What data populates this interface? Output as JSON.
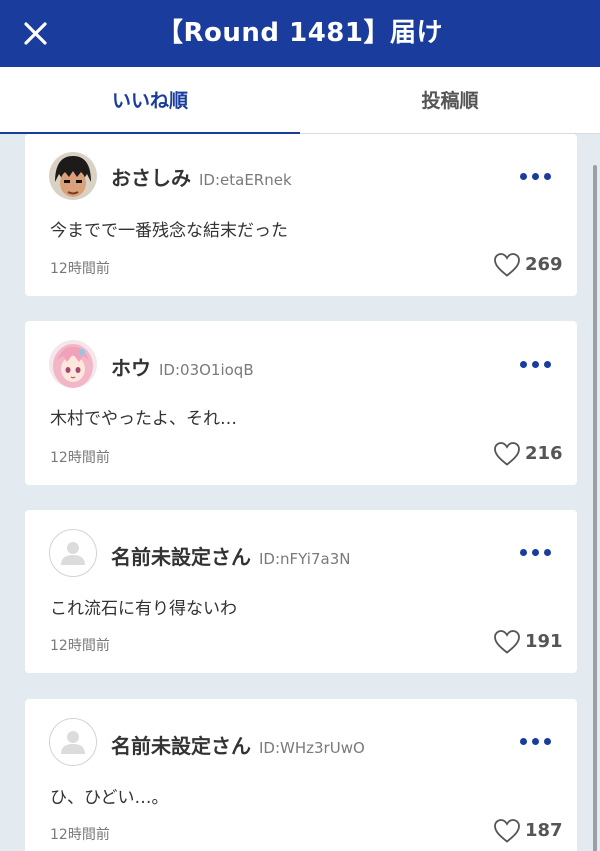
{
  "header": {
    "title": "【Round 1481】届け",
    "close_icon": "close-icon"
  },
  "tabs": [
    {
      "label": "いいね順",
      "active": true
    },
    {
      "label": "投稿順",
      "active": false
    }
  ],
  "colors": {
    "brand": "#1a3c9c",
    "background": "#e3eaf0",
    "card": "#ffffff",
    "text": "#333333",
    "muted": "#7a7a7a"
  },
  "comments": [
    {
      "name": "おさしみ",
      "id": "ID:etaERnek",
      "text": "今までで一番残念な結末だった",
      "time": "12時間前",
      "likes": "269",
      "avatar": "anime-boxer-avatar"
    },
    {
      "name": "ホウ",
      "id": "ID:03O1ioqB",
      "text": "木村でやったよ、それ…",
      "time": "12時間前",
      "likes": "216",
      "avatar": "anime-girl-avatar"
    },
    {
      "name": "名前未設定さん",
      "id": "ID:nFYi7a3N",
      "text": "これ流石に有り得ないわ",
      "time": "12時間前",
      "likes": "191",
      "avatar": "default-user-avatar"
    },
    {
      "name": "名前未設定さん",
      "id": "ID:WHz3rUwO",
      "text": "ひ、ひどい…。",
      "time": "12時間前",
      "likes": "187",
      "avatar": "default-user-avatar"
    }
  ]
}
